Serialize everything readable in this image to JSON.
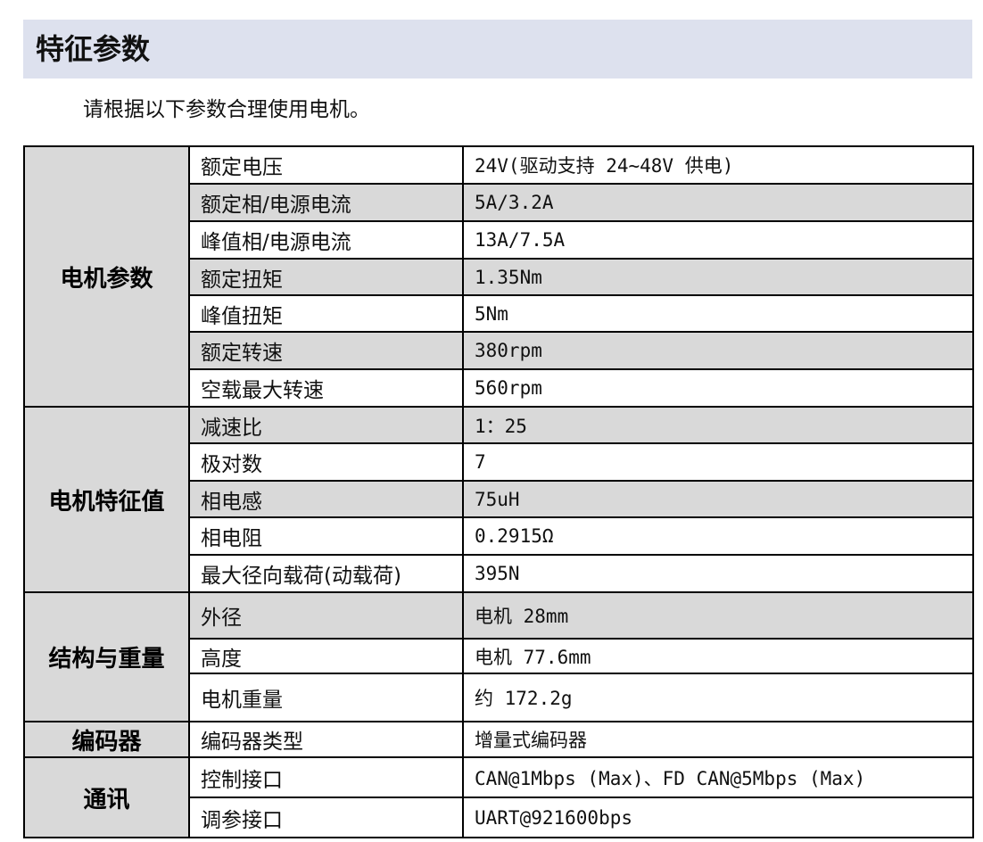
{
  "section_title": "特征参数",
  "intro_text": "请根据以下参数合理使用电机。",
  "groups": [
    {
      "category": "电机参数",
      "rows": [
        {
          "param": "额定电压",
          "value": "24V(驱动支持 24~48V 供电)"
        },
        {
          "param": "额定相/电源电流",
          "value": "5A/3.2A"
        },
        {
          "param": "峰值相/电源电流",
          "value": "13A/7.5A"
        },
        {
          "param": "额定扭矩",
          "value": "1.35Nm"
        },
        {
          "param": "峰值扭矩",
          "value": "5Nm"
        },
        {
          "param": "额定转速",
          "value": "380rpm"
        },
        {
          "param": "空载最大转速",
          "value": "560rpm"
        }
      ]
    },
    {
      "category": "电机特征值",
      "rows": [
        {
          "param": "减速比",
          "value": "1：25"
        },
        {
          "param": "极对数",
          "value": "7"
        },
        {
          "param": "相电感",
          "value": "75uH"
        },
        {
          "param": "相电阻",
          "value": "0.2915Ω"
        },
        {
          "param": "最大径向载荷(动载荷)",
          "value": "395N"
        }
      ]
    },
    {
      "category": "结构与重量",
      "rows": [
        {
          "param": "外径",
          "value": "电机 28mm"
        },
        {
          "param": "高度",
          "value": "电机 77.6mm"
        },
        {
          "param": "电机重量",
          "value": "约 172.2g"
        }
      ]
    },
    {
      "category": "编码器",
      "rows": [
        {
          "param": "编码器类型",
          "value": "增量式编码器"
        }
      ]
    },
    {
      "category": "通讯",
      "rows": [
        {
          "param": "控制接口",
          "value": "CAN@1Mbps (Max)、FD CAN@5Mbps (Max)"
        },
        {
          "param": "调参接口",
          "value": "UART@921600bps"
        }
      ]
    }
  ]
}
